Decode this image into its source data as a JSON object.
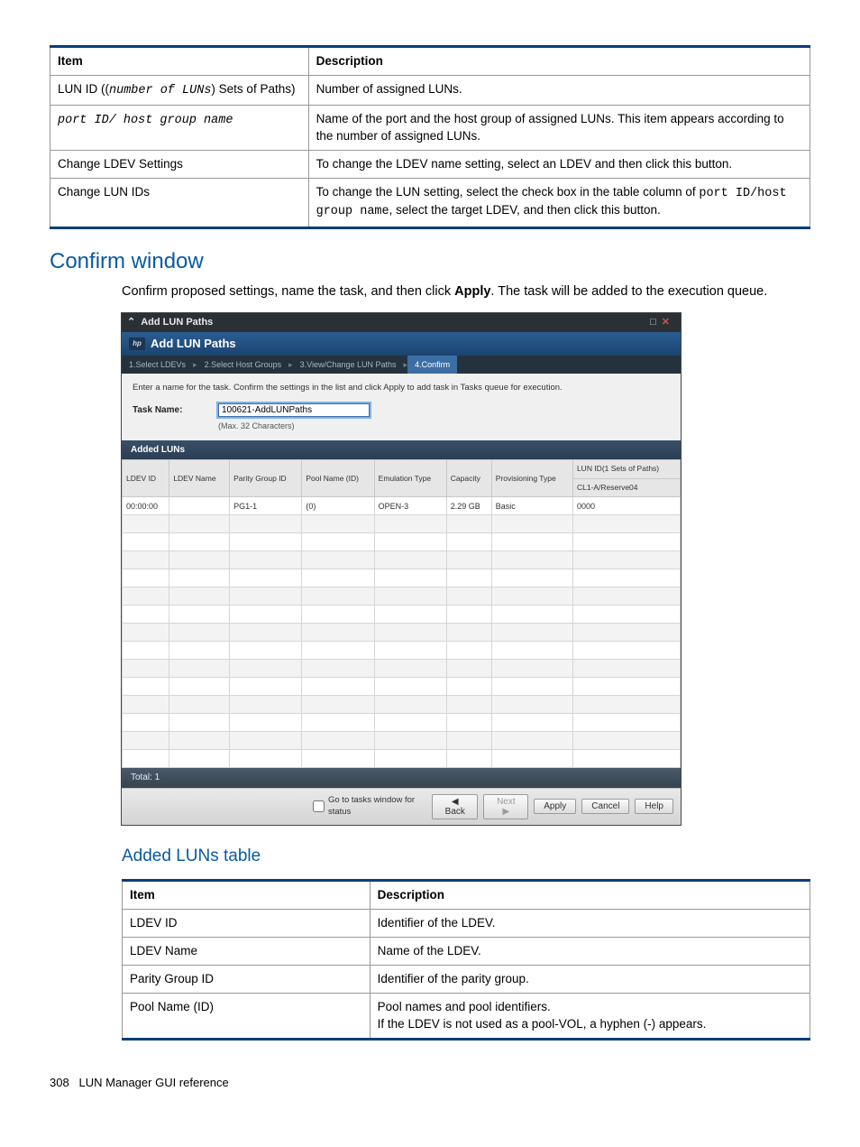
{
  "top_table": {
    "headers": [
      "Item",
      "Description"
    ],
    "rows": [
      {
        "item_pre": "LUN ID ((",
        "item_code": "number of LUNs",
        "item_post": ") Sets of Paths)",
        "desc": "Number of assigned LUNs."
      },
      {
        "item_code2": "port ID/ host group name",
        "desc": "Name of the port and the host group of assigned LUNs. This item appears according to the number of assigned LUNs."
      },
      {
        "item": "Change LDEV Settings",
        "desc": "To change the LDEV name setting, select an LDEV and then click this button."
      },
      {
        "item": "Change LUN IDs",
        "desc_pre": "To change the LUN setting, select the check box in the table column of ",
        "desc_code": "port ID/host group name",
        "desc_post": ", select the target LDEV, and then click this button."
      }
    ]
  },
  "section_title": "Confirm window",
  "section_body_pre": "Confirm proposed settings, name the task, and then click ",
  "section_body_bold": "Apply",
  "section_body_post": ". The task will be added to the execution queue.",
  "screenshot": {
    "titlebar": "Add LUN Paths",
    "ribbon": "Add LUN Paths",
    "steps": [
      "1.Select LDEVs",
      "2.Select Host Groups",
      "3.View/Change LUN Paths",
      "4.Confirm"
    ],
    "active_step_index": 3,
    "instruction": "Enter a name for the task. Confirm the settings in the list and click Apply to add task in Tasks queue for execution.",
    "task_label": "Task Name:",
    "task_value": "100621-AddLUNPaths",
    "task_hint": "(Max. 32 Characters)",
    "added_bar": "Added LUNs",
    "grid_headers_row1": [
      "LDEV ID",
      "LDEV Name",
      "Parity Group ID",
      "Pool Name (ID)",
      "Emulation Type",
      "Capacity",
      "Provisioning Type",
      "LUN ID(1 Sets of Paths)"
    ],
    "grid_headers_row2_last": "CL1-A/Reserve04",
    "grid_row": [
      "00:00:00",
      "",
      "PG1-1",
      "(0)",
      "OPEN-3",
      "2.29 GB",
      "Basic",
      "0000"
    ],
    "empty_rows": 14,
    "total": "Total: 1",
    "footer_tasks": "Go to tasks window for status",
    "buttons": {
      "back": "◀ Back",
      "next": "Next ▶",
      "apply": "Apply",
      "cancel": "Cancel",
      "help": "Help"
    }
  },
  "subsection_title": "Added LUNs table",
  "bottom_table": {
    "headers": [
      "Item",
      "Description"
    ],
    "rows": [
      {
        "item": "LDEV ID",
        "desc": "Identifier of the LDEV."
      },
      {
        "item": "LDEV Name",
        "desc": "Name of the LDEV."
      },
      {
        "item": "Parity Group ID",
        "desc": "Identifier of the parity group."
      },
      {
        "item": "Pool Name (ID)",
        "desc": "Pool names and pool identifiers.\nIf the LDEV is not used as a pool-VOL, a hyphen (-) appears."
      }
    ]
  },
  "footer": {
    "page": "308",
    "title": "LUN Manager GUI reference"
  }
}
